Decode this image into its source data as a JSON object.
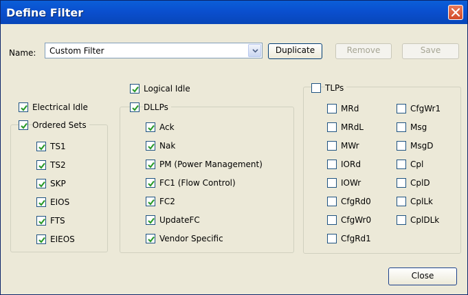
{
  "window": {
    "title": "Define Filter"
  },
  "name_row": {
    "label": "Name:",
    "value": "Custom Filter"
  },
  "buttons": {
    "duplicate": "Duplicate",
    "remove": "Remove",
    "save": "Save",
    "close": "Close"
  },
  "colors": {
    "checkmark": "#2a9a2a",
    "titlebar": "#0a4fcf"
  },
  "left_group": {
    "electrical_idle": {
      "label": "Electrical Idle",
      "checked": true
    },
    "ordered_sets": {
      "label": "Ordered Sets",
      "checked": true
    },
    "items": [
      {
        "label": "TS1",
        "checked": true
      },
      {
        "label": "TS2",
        "checked": true
      },
      {
        "label": "SKP",
        "checked": true
      },
      {
        "label": "EIOS",
        "checked": true
      },
      {
        "label": "FTS",
        "checked": true
      },
      {
        "label": "EIEOS",
        "checked": true
      }
    ]
  },
  "middle_group": {
    "logical_idle": {
      "label": "Logical Idle",
      "checked": true
    },
    "dllps": {
      "label": "DLLPs",
      "checked": true
    },
    "items": [
      {
        "label": "Ack",
        "checked": true
      },
      {
        "label": "Nak",
        "checked": true
      },
      {
        "label": "PM (Power Management)",
        "checked": true
      },
      {
        "label": "FC1 (Flow Control)",
        "checked": true
      },
      {
        "label": "FC2",
        "checked": true
      },
      {
        "label": "UpdateFC",
        "checked": true
      },
      {
        "label": "Vendor Specific",
        "checked": true
      }
    ]
  },
  "right_group": {
    "tlps": {
      "label": "TLPs",
      "checked": false
    },
    "col1": [
      {
        "label": "MRd",
        "checked": false
      },
      {
        "label": "MRdL",
        "checked": false
      },
      {
        "label": "MWr",
        "checked": false
      },
      {
        "label": "IORd",
        "checked": false
      },
      {
        "label": "IOWr",
        "checked": false
      },
      {
        "label": "CfgRd0",
        "checked": false
      },
      {
        "label": "CfgWr0",
        "checked": false
      },
      {
        "label": "CfgRd1",
        "checked": false
      }
    ],
    "col2": [
      {
        "label": "CfgWr1",
        "checked": false
      },
      {
        "label": "Msg",
        "checked": false
      },
      {
        "label": "MsgD",
        "checked": false
      },
      {
        "label": "Cpl",
        "checked": false
      },
      {
        "label": "CplD",
        "checked": false
      },
      {
        "label": "CplLk",
        "checked": false
      },
      {
        "label": "CplDLk",
        "checked": false
      }
    ]
  }
}
